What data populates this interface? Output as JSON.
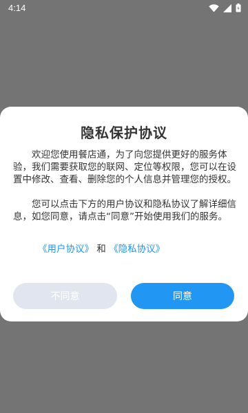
{
  "status_bar": {
    "time": "4:14",
    "icons": [
      "wifi-icon",
      "signal-icon",
      "battery-icon"
    ]
  },
  "dialog": {
    "title": "隐私保护协议",
    "paragraph_1": "欢迎您使用餐店通，为了向您提供更好的服务体验，我们需要获取您的联网、定位等权限，您可以在设置中修改、查看、删除您的个人信息并管理您的授权。",
    "paragraph_2": "您可以点击下方的用户协议和隐私协议了解详细信息，如您同意，请点击“同意”开始使用我们的服务。",
    "user_agreement_link": "《用户协议》",
    "link_separator": "和",
    "privacy_agreement_link": "《隐私协议》",
    "disagree_label": "不同意",
    "agree_label": "同意"
  },
  "colors": {
    "accent": "#2196f3",
    "disagree_button_bg": "#e1e5ef",
    "overlay": "#747474"
  }
}
